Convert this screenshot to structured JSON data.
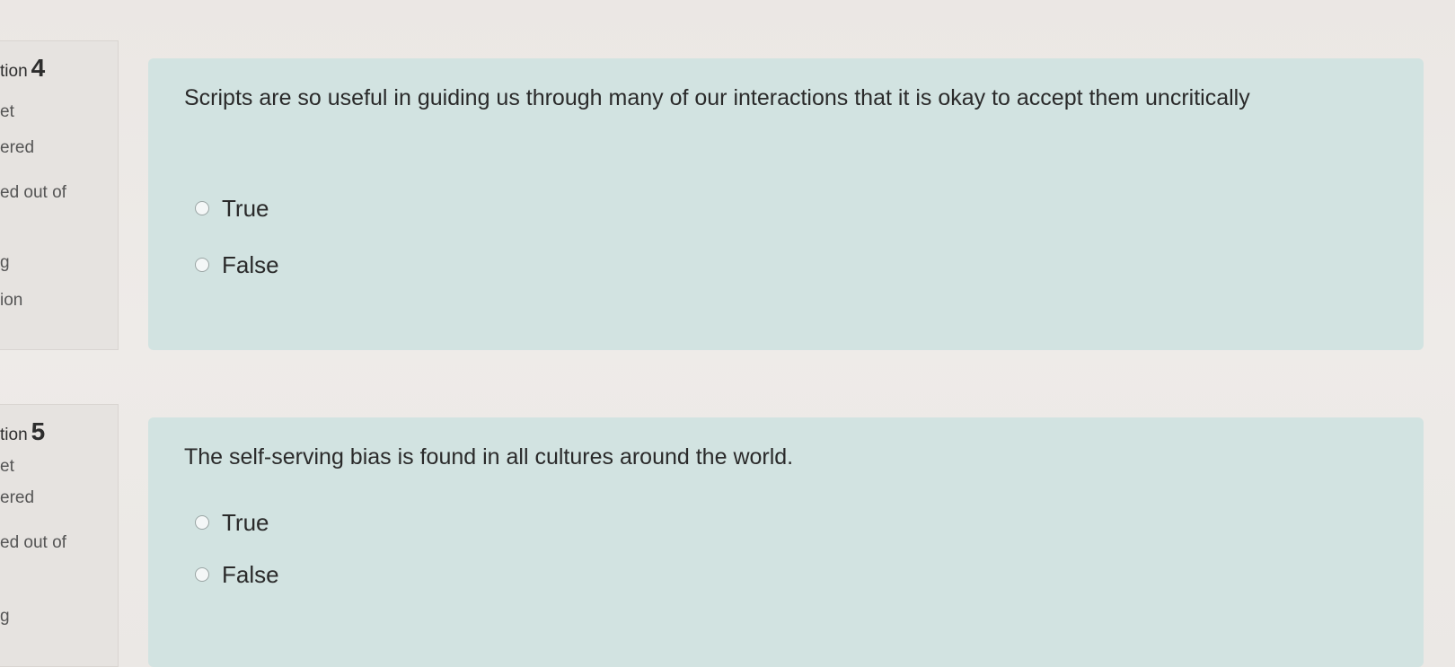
{
  "questions": [
    {
      "prefix": "tion",
      "number": "4",
      "info_lines": [
        "et",
        "ered",
        "ed out of",
        "g",
        "ion"
      ],
      "text": "Scripts are so useful in guiding us through many of our interactions that it is okay to accept them uncritically",
      "options": [
        "True",
        "False"
      ]
    },
    {
      "prefix": "tion",
      "number": "5",
      "info_lines": [
        "et",
        "ered",
        "ed out of",
        "g"
      ],
      "text": "The self-serving bias is found in all cultures around the world.",
      "options": [
        "True",
        "False"
      ]
    }
  ]
}
